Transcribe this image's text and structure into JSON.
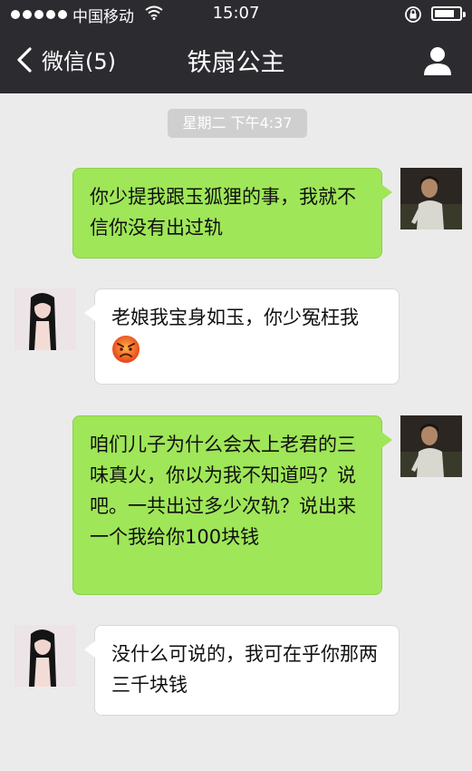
{
  "status_bar": {
    "carrier": "中国移动",
    "time": "15:07"
  },
  "nav": {
    "back_label": "微信(5)",
    "title": "铁扇公主"
  },
  "timestamp": "星期二 下午4:37",
  "messages": [
    {
      "from": "me",
      "text": "你少提我跟玉狐狸的事，我就不信你没有出过轨"
    },
    {
      "from": "other",
      "text": "老娘我宝身如玉，你少冤枉我",
      "emoji": "angry-face-icon"
    },
    {
      "from": "me",
      "text": "咱们儿子为什么会太上老君的三味真火，你以为我不知道吗？说吧。一共出过多少次轨？说出来一个我给你100块钱"
    },
    {
      "from": "other",
      "text": "没什么可说的，我可在乎你那两三千块钱"
    }
  ],
  "colors": {
    "nav_bg": "#2c2c30",
    "chat_bg": "#ebebeb",
    "sent_bubble": "#9fe658",
    "received_bubble": "#ffffff"
  }
}
